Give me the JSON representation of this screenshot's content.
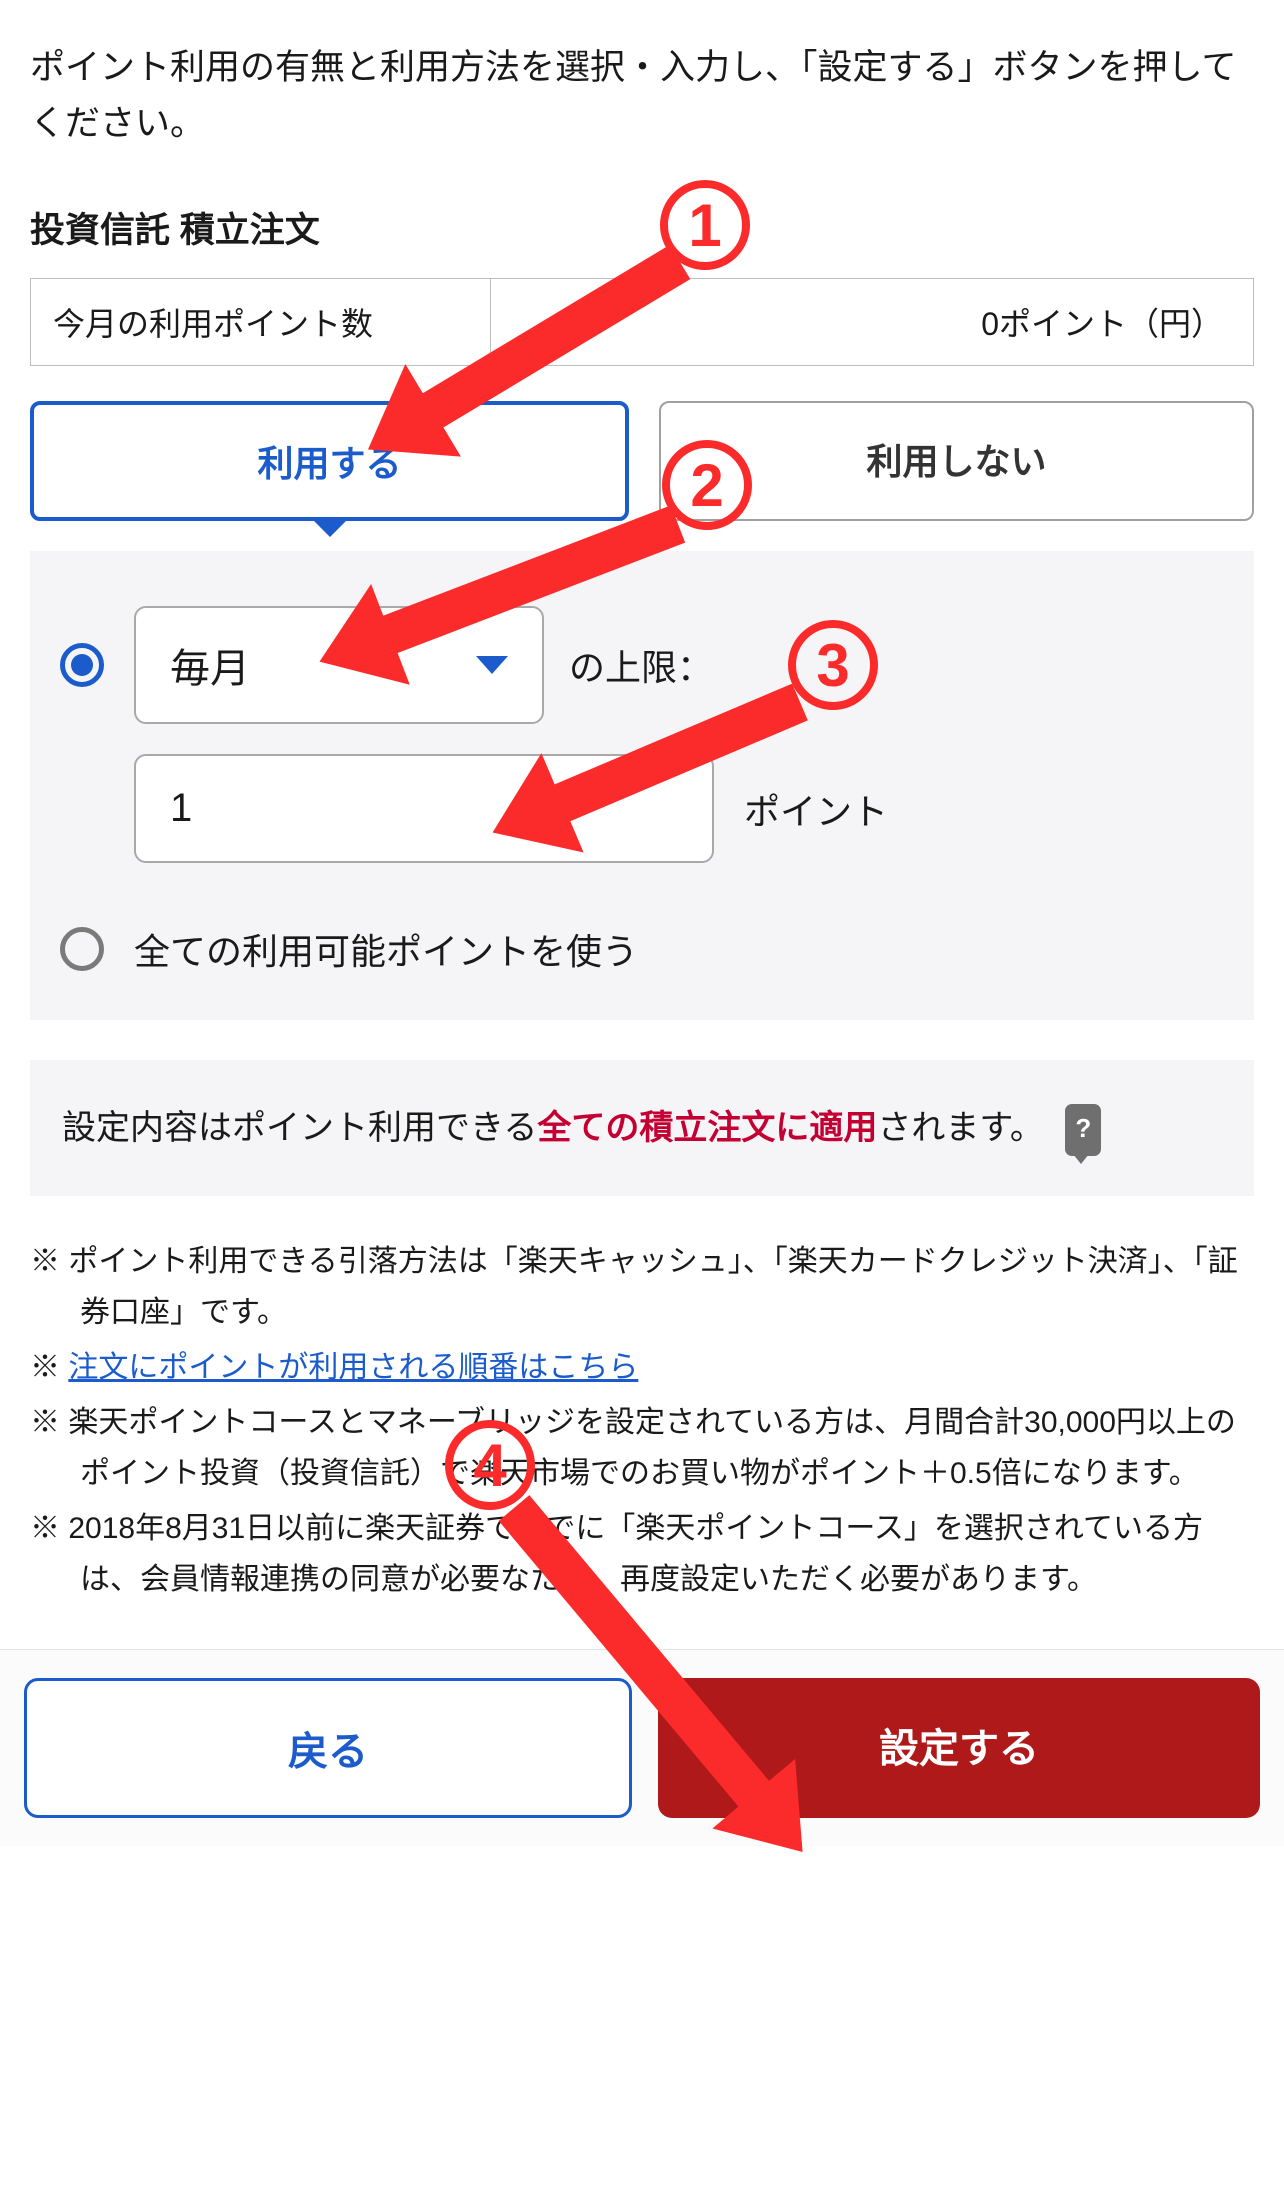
{
  "intro": "ポイント利用の有無と利用方法を選択・入力し、「設定する」ボタンを押してください。",
  "sectionTitle": "投資信託 積立注文",
  "pointsRow": {
    "label": "今月の利用ポイント数",
    "value": "0ポイント（円）"
  },
  "toggle": {
    "use": "利用する",
    "notUse": "利用しない"
  },
  "option1": {
    "selectValue": "毎月",
    "suffix": "の上限：",
    "inputValue": "1",
    "unit": "ポイント"
  },
  "option2": {
    "label": "全ての利用可能ポイントを使う"
  },
  "notice": {
    "pre": "設定内容はポイント利用できる",
    "highlight": "全ての積立注文に適用",
    "post": "されます。",
    "help": "?"
  },
  "notes": {
    "n1": "ポイント利用できる引落方法は「楽天キャッシュ」、「楽天カードクレジット決済」、「証券口座」です。",
    "n2link": "注文にポイントが利用される順番はこちら",
    "n3": "楽天ポイントコースとマネーブリッジを設定されている方は、月間合計30,000円以上のポイント投資（投資信託）で楽天市場でのお買い物がポイント＋0.5倍になります。",
    "n4": "2018年8月31日以前に楽天証券ですでに「楽天ポイントコース」を選択されている方は、会員情報連携の同意が必要なため、再度設定いただく必要があります。"
  },
  "footer": {
    "back": "戻る",
    "set": "設定する"
  },
  "anno": {
    "a1": "1",
    "a2": "2",
    "a3": "3",
    "a4": "4"
  }
}
